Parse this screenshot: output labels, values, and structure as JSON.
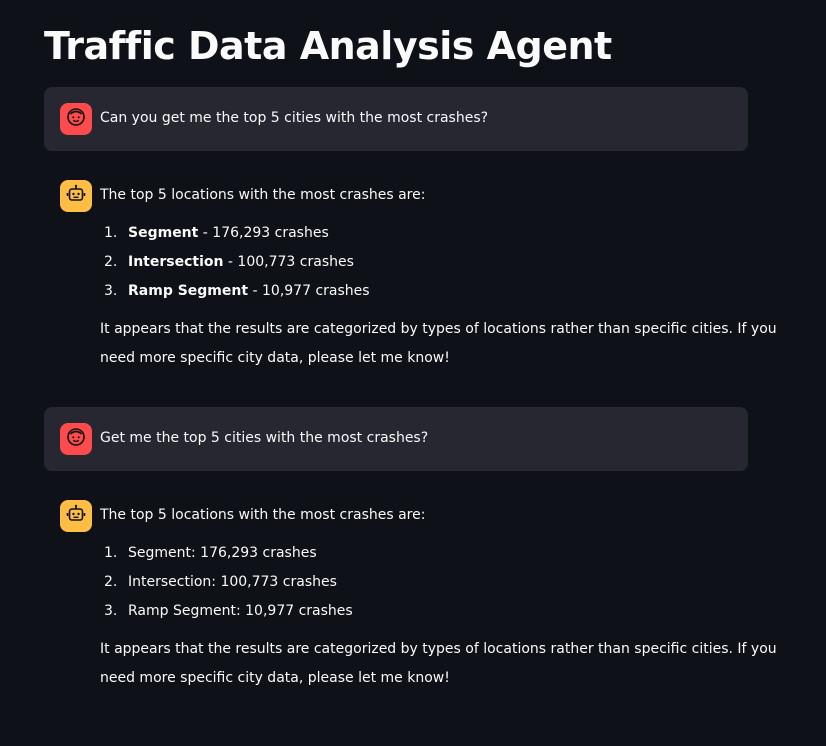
{
  "page": {
    "title": "Traffic Data Analysis Agent"
  },
  "messages": [
    {
      "role": "user",
      "text": "Can you get me the top 5 cities with the most crashes?"
    },
    {
      "role": "assistant",
      "intro": "The top 5 locations with the most crashes are:",
      "items": [
        {
          "num": "1.",
          "label": "Segment",
          "rest": " - 176,293 crashes"
        },
        {
          "num": "2.",
          "label": "Intersection",
          "rest": " - 100,773 crashes"
        },
        {
          "num": "3.",
          "label": "Ramp Segment",
          "rest": " - 10,977 crashes"
        }
      ],
      "footer_line1": "It appears that the results are categorized by types of locations rather than specific cities. If you",
      "footer_line2": "need more specific city data, please let me know!"
    },
    {
      "role": "user",
      "text": "Get me the top 5 cities with the most crashes?"
    },
    {
      "role": "assistant",
      "intro": "The top 5 locations with the most crashes are:",
      "items": [
        {
          "num": "1.",
          "text": "Segment: 176,293 crashes"
        },
        {
          "num": "2.",
          "text": "Intersection: 100,773 crashes"
        },
        {
          "num": "3.",
          "text": "Ramp Segment: 10,977 crashes"
        }
      ],
      "footer_line1": "It appears that the results are categorized by types of locations rather than specific cities. If you",
      "footer_line2": "need more specific city data, please let me know!"
    }
  ],
  "icons": {
    "user_avatar": "user-face-icon",
    "assistant_avatar": "robot-face-icon"
  },
  "colors": {
    "background": "#0e1117",
    "user_bubble": "#262730",
    "user_avatar": "#ff4b4b",
    "assistant_avatar": "#ffbd45",
    "text": "#fafafa"
  }
}
